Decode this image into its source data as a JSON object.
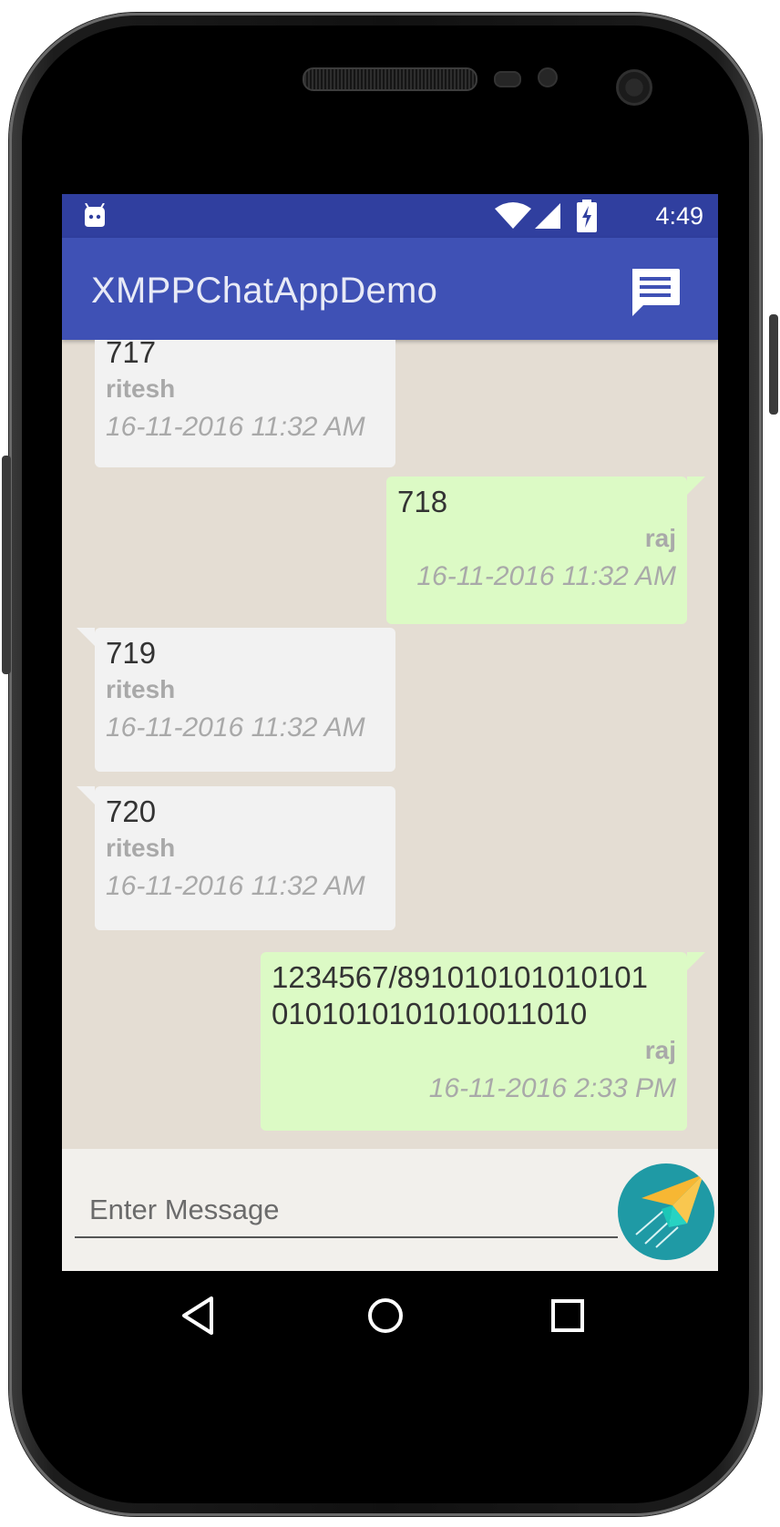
{
  "status_bar": {
    "time": "4:49",
    "icons": [
      "android-notification-icon",
      "wifi-icon",
      "signal-icon",
      "battery-charging-icon"
    ]
  },
  "app_bar": {
    "title": "XMPPChatAppDemo",
    "action_icon": "message-icon"
  },
  "messages": [
    {
      "direction": "incoming",
      "text": "717",
      "sender": "ritesh",
      "time": "16-11-2016 11:32 AM"
    },
    {
      "direction": "outgoing",
      "text": "718",
      "sender": "raj",
      "time": "16-11-2016 11:32 AM"
    },
    {
      "direction": "incoming",
      "text": "719",
      "sender": "ritesh",
      "time": "16-11-2016 11:32 AM"
    },
    {
      "direction": "incoming",
      "text": "720",
      "sender": "ritesh",
      "time": "16-11-2016 11:32 AM"
    },
    {
      "direction": "outgoing",
      "text": "1234567/891010101010101",
      "text_line2": "0101010101010011010",
      "sender": "raj",
      "time": "16-11-2016 2:33 PM"
    }
  ],
  "composer": {
    "placeholder": "Enter Message",
    "value": "",
    "send_icon": "paper-plane-icon"
  },
  "nav_bar": {
    "icons": [
      "back-icon",
      "home-icon",
      "recents-icon"
    ]
  },
  "colors": {
    "status_bar": "#303f9f",
    "app_bar": "#3f51b5",
    "chat_background": "#e4ddd3",
    "incoming_bubble": "#f2f2f2",
    "outgoing_bubble": "#dcfac5",
    "send_button": "#1f9aa5"
  }
}
